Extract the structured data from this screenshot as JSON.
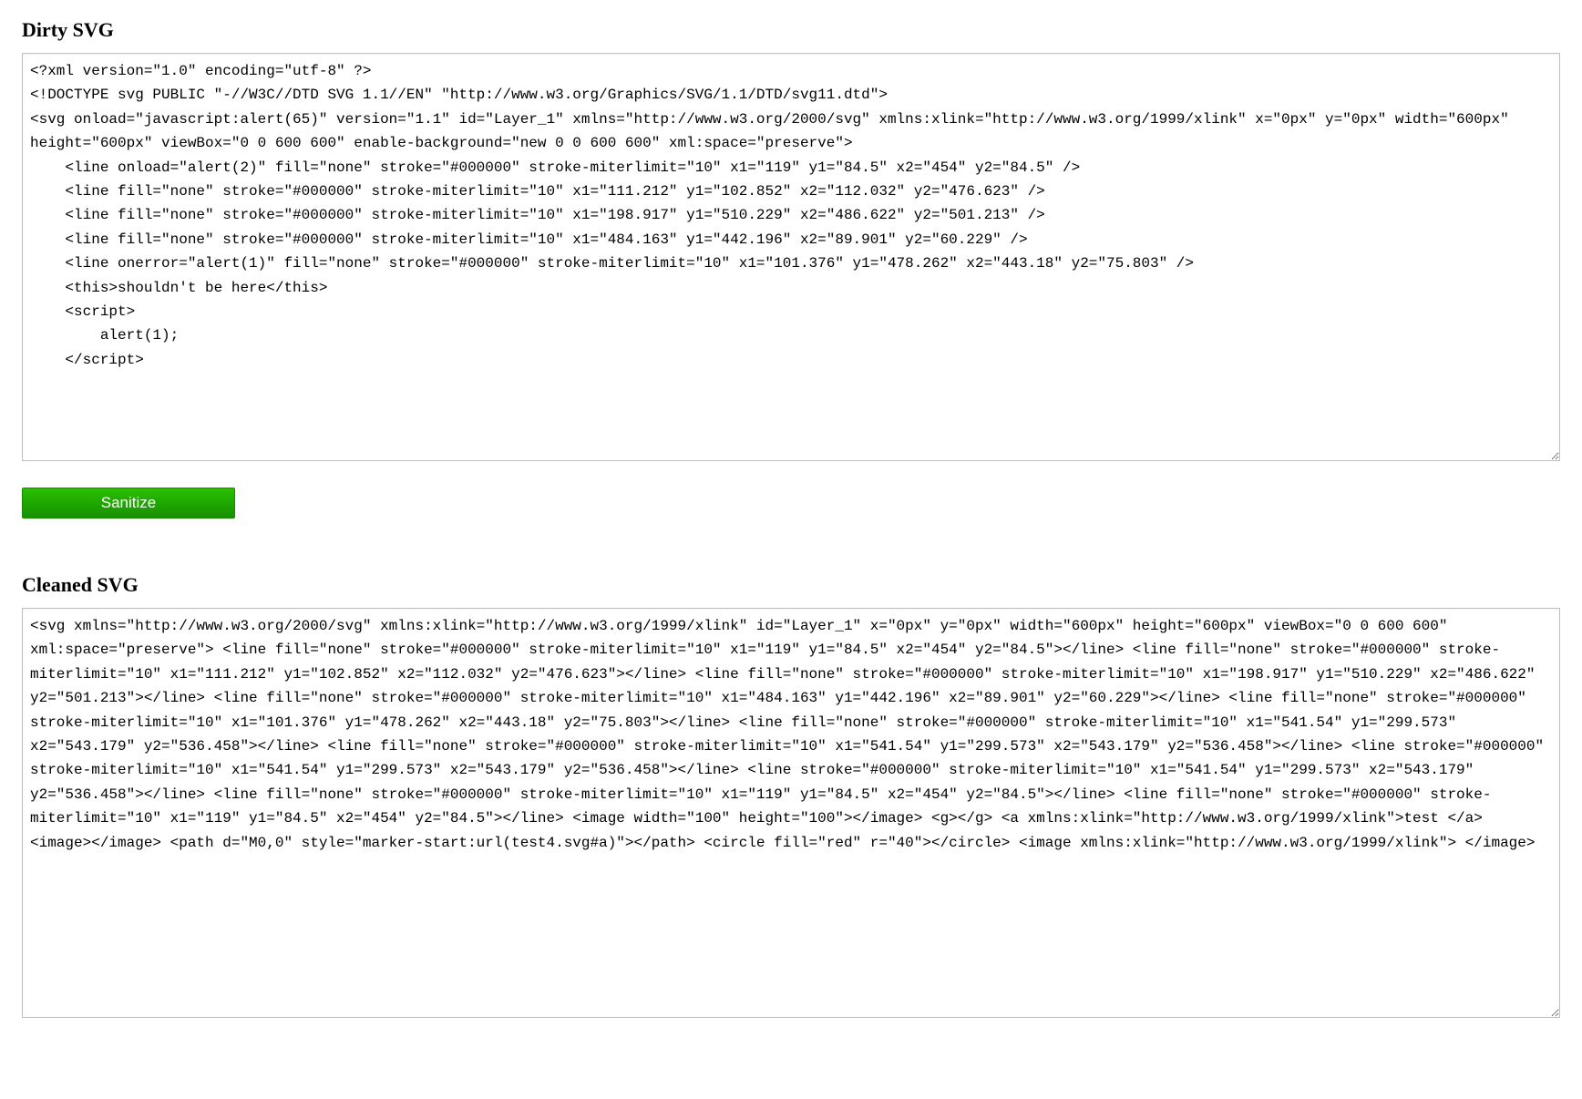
{
  "headings": {
    "dirty": "Dirty SVG",
    "cleaned": "Cleaned SVG"
  },
  "button": {
    "sanitize_label": "Sanitize"
  },
  "textareas": {
    "dirty_value": "<?xml version=\"1.0\" encoding=\"utf-8\" ?>\n<!DOCTYPE svg PUBLIC \"-//W3C//DTD SVG 1.1//EN\" \"http://www.w3.org/Graphics/SVG/1.1/DTD/svg11.dtd\">\n<svg onload=\"javascript:alert(65)\" version=\"1.1\" id=\"Layer_1\" xmlns=\"http://www.w3.org/2000/svg\" xmlns:xlink=\"http://www.w3.org/1999/xlink\" x=\"0px\" y=\"0px\" width=\"600px\" height=\"600px\" viewBox=\"0 0 600 600\" enable-background=\"new 0 0 600 600\" xml:space=\"preserve\">\n    <line onload=\"alert(2)\" fill=\"none\" stroke=\"#000000\" stroke-miterlimit=\"10\" x1=\"119\" y1=\"84.5\" x2=\"454\" y2=\"84.5\" />\n    <line fill=\"none\" stroke=\"#000000\" stroke-miterlimit=\"10\" x1=\"111.212\" y1=\"102.852\" x2=\"112.032\" y2=\"476.623\" />\n    <line fill=\"none\" stroke=\"#000000\" stroke-miterlimit=\"10\" x1=\"198.917\" y1=\"510.229\" x2=\"486.622\" y2=\"501.213\" />\n    <line fill=\"none\" stroke=\"#000000\" stroke-miterlimit=\"10\" x1=\"484.163\" y1=\"442.196\" x2=\"89.901\" y2=\"60.229\" />\n    <line onerror=\"alert(1)\" fill=\"none\" stroke=\"#000000\" stroke-miterlimit=\"10\" x1=\"101.376\" y1=\"478.262\" x2=\"443.18\" y2=\"75.803\" />\n    <this>shouldn't be here</this>\n    <script>\n        alert(1);\n    </script>",
    "cleaned_value": "<svg xmlns=\"http://www.w3.org/2000/svg\" xmlns:xlink=\"http://www.w3.org/1999/xlink\" id=\"Layer_1\" x=\"0px\" y=\"0px\" width=\"600px\" height=\"600px\" viewBox=\"0 0 600 600\" xml:space=\"preserve\"> <line fill=\"none\" stroke=\"#000000\" stroke-miterlimit=\"10\" x1=\"119\" y1=\"84.5\" x2=\"454\" y2=\"84.5\"></line> <line fill=\"none\" stroke=\"#000000\" stroke-miterlimit=\"10\" x1=\"111.212\" y1=\"102.852\" x2=\"112.032\" y2=\"476.623\"></line> <line fill=\"none\" stroke=\"#000000\" stroke-miterlimit=\"10\" x1=\"198.917\" y1=\"510.229\" x2=\"486.622\" y2=\"501.213\"></line> <line fill=\"none\" stroke=\"#000000\" stroke-miterlimit=\"10\" x1=\"484.163\" y1=\"442.196\" x2=\"89.901\" y2=\"60.229\"></line> <line fill=\"none\" stroke=\"#000000\" stroke-miterlimit=\"10\" x1=\"101.376\" y1=\"478.262\" x2=\"443.18\" y2=\"75.803\"></line> <line fill=\"none\" stroke=\"#000000\" stroke-miterlimit=\"10\" x1=\"541.54\" y1=\"299.573\" x2=\"543.179\" y2=\"536.458\"></line> <line fill=\"none\" stroke=\"#000000\" stroke-miterlimit=\"10\" x1=\"541.54\" y1=\"299.573\" x2=\"543.179\" y2=\"536.458\"></line> <line stroke=\"#000000\" stroke-miterlimit=\"10\" x1=\"541.54\" y1=\"299.573\" x2=\"543.179\" y2=\"536.458\"></line> <line stroke=\"#000000\" stroke-miterlimit=\"10\" x1=\"541.54\" y1=\"299.573\" x2=\"543.179\" y2=\"536.458\"></line> <line fill=\"none\" stroke=\"#000000\" stroke-miterlimit=\"10\" x1=\"119\" y1=\"84.5\" x2=\"454\" y2=\"84.5\"></line> <line fill=\"none\" stroke=\"#000000\" stroke-miterlimit=\"10\" x1=\"119\" y1=\"84.5\" x2=\"454\" y2=\"84.5\"></line> <image width=\"100\" height=\"100\"></image> <g></g> <a xmlns:xlink=\"http://www.w3.org/1999/xlink\">test </a> <image></image> <path d=\"M0,0\" style=\"marker-start:url(test4.svg#a)\"></path> <circle fill=\"red\" r=\"40\"></circle> <image xmlns:xlink=\"http://www.w3.org/1999/xlink\"> </image>"
  }
}
